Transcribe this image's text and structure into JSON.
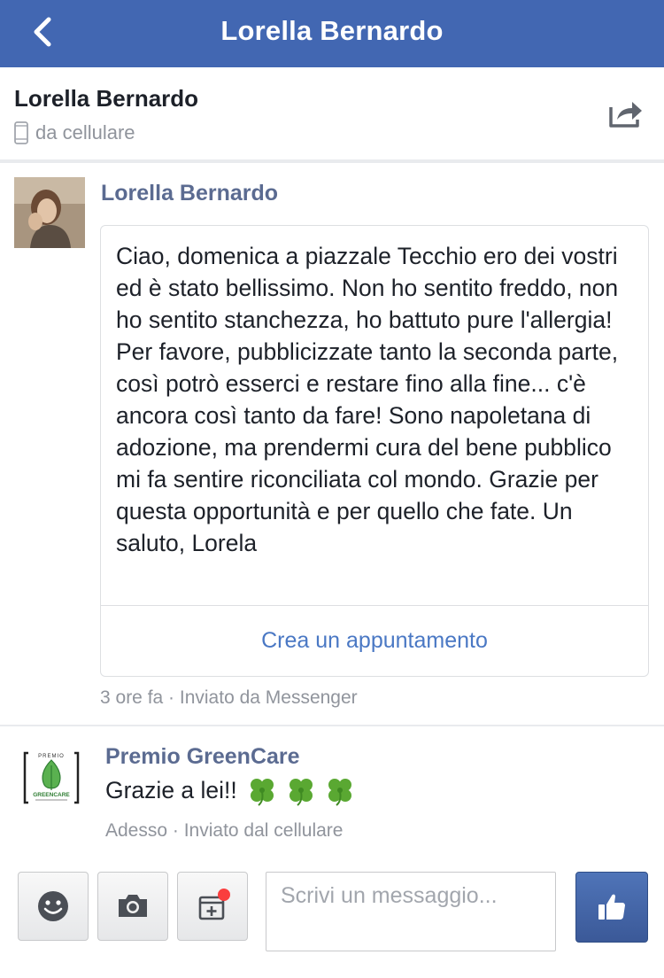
{
  "navbar": {
    "title": "Lorella Bernardo"
  },
  "conversation": {
    "name": "Lorella Bernardo",
    "subtitle": "da cellulare"
  },
  "messages": [
    {
      "sender": "Lorella Bernardo",
      "text": "Ciao, domenica a piazzale Tecchio ero dei vostri ed è stato bellissimo. Non ho sentito freddo, non ho sentito stanchezza, ho battuto pure l'allergia! Per favore, pubblicizzate tanto la seconda parte, così potrò esserci e restare fino alla fine... c'è ancora così tanto da fare! Sono napoletana di adozione, ma prendermi cura del bene pubblico mi fa sentire riconciliata col mondo. Grazie per questa opportunità e per quello che fate. Un saluto, Lorela",
      "action_label": "Crea un appuntamento",
      "meta": "3 ore fa · Inviato da Messenger"
    },
    {
      "sender": "Premio GreenCare",
      "text": "Grazie a lei!!",
      "emoji": [
        "four-leaf-clover",
        "four-leaf-clover",
        "four-leaf-clover"
      ],
      "meta": "Adesso · Inviato dal cellulare",
      "logo_text": [
        "PREMIO",
        "GREENCARE"
      ]
    }
  ],
  "composer": {
    "placeholder": "Scrivi un messaggio..."
  },
  "colors": {
    "navbar": "#4267b2",
    "sender_name": "#5b6b91",
    "link": "#4a78c4",
    "meta": "#90949c",
    "like_button": "#3b5998",
    "badge": "#fa3e3e"
  },
  "icons": [
    "back-chevron-icon",
    "share-icon",
    "phone-icon",
    "emoji-icon",
    "camera-icon",
    "calendar-add-icon",
    "thumbs-up-icon"
  ]
}
